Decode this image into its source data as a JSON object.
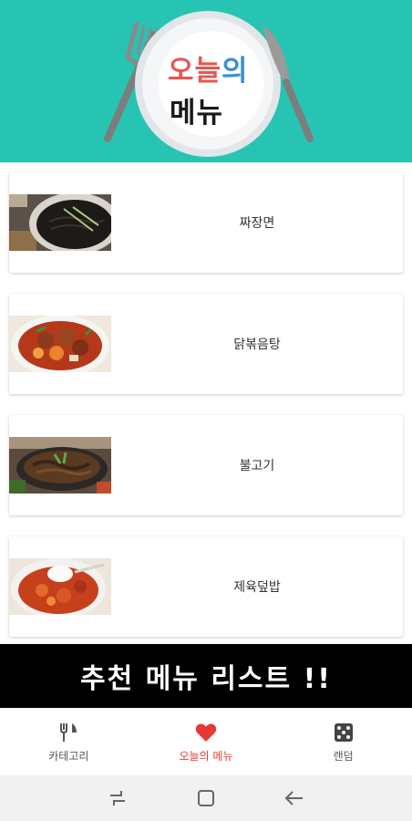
{
  "header": {
    "logo_line1_part1": "오늘",
    "logo_line1_part2": "의",
    "logo_line2": "메뉴",
    "background_color": "#27c4b4",
    "logo_colors": [
      "#e8554e",
      "#3a8fd8",
      "#1a1a1a"
    ]
  },
  "menu": {
    "items": [
      {
        "name": "짜장면",
        "image_icon": "jajangmyeon-photo"
      },
      {
        "name": "닭볶음탕",
        "image_icon": "dakbokkeumtang-photo"
      },
      {
        "name": "불고기",
        "image_icon": "bulgogi-photo"
      },
      {
        "name": "제육덮밥",
        "image_icon": "jeyukdeopbap-photo"
      }
    ]
  },
  "banner": {
    "text": "추천 메뉴 리스트 !!"
  },
  "bottom_nav": {
    "items": [
      {
        "label": "카테고리",
        "icon": "fork-knife-icon",
        "active": false
      },
      {
        "label": "오늘의 메뉴",
        "icon": "heart-icon",
        "active": true
      },
      {
        "label": "랜덤",
        "icon": "dice-icon",
        "active": false
      }
    ],
    "active_color": "#e53935"
  },
  "system_nav": {
    "buttons": [
      "recent-apps-icon",
      "home-icon",
      "back-icon"
    ]
  }
}
